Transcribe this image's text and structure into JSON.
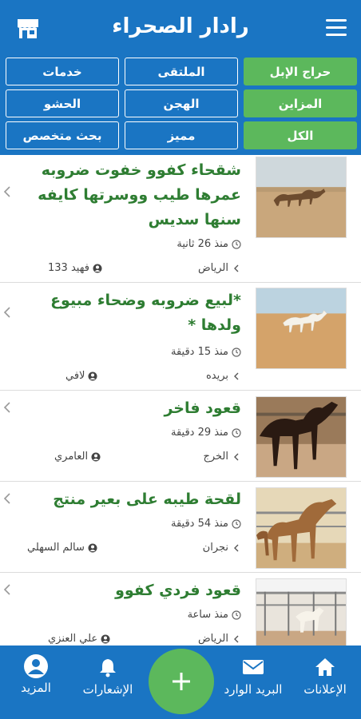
{
  "app": {
    "title": "رادار الصحراء",
    "icons": {
      "menu": "hamburger-menu-icon",
      "store": "store-icon"
    },
    "colors": {
      "primary": "#1a75c3",
      "accent": "#5cb85c",
      "title_text": "#2e7d32"
    }
  },
  "categories": [
    {
      "label": "حراج الإبل",
      "active": true
    },
    {
      "label": "الملتقى",
      "active": false
    },
    {
      "label": "خدمات",
      "active": false
    },
    {
      "label": "المزاين",
      "active": true
    },
    {
      "label": "الهجن",
      "active": false
    },
    {
      "label": "الحشو",
      "active": false
    },
    {
      "label": "الكل",
      "active": true
    },
    {
      "label": "مميز",
      "active": false
    },
    {
      "label": "بحث متخصص",
      "active": false
    }
  ],
  "listings": [
    {
      "title": "شقحاء كفوو خفوت ضروبه عمرها طيب ووسرتها كايفه سنها سديس",
      "time": "منذ 26 ثانية",
      "city": "الرياض",
      "user": "فهيد 133"
    },
    {
      "title": "*لبيع ضروبه وضحاء مبيوع ولدها *",
      "time": "منذ 15 دقيقة",
      "city": "بريده",
      "user": "لافي"
    },
    {
      "title": "قعود فاخر",
      "time": "منذ 29 دقيقة",
      "city": "الخرج",
      "user": "العامري"
    },
    {
      "title": "لقحة طيبه على بعير منتج",
      "time": "منذ 54 دقيقة",
      "city": "نجران",
      "user": "سالم السهلي"
    },
    {
      "title": "قعود فردي كفوو",
      "time": "منذ ساعة",
      "city": "الرياض",
      "user": "علي العنزي"
    }
  ],
  "bottom_nav": {
    "ads": "الإعلانات",
    "inbox": "البريد الوارد",
    "notifications": "الإشعارات",
    "more": "المزيد",
    "add_icon": "plus-icon"
  }
}
